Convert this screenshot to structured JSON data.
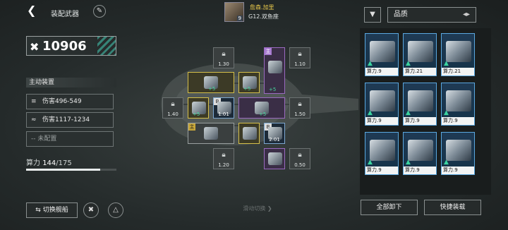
{
  "header": {
    "title": "装配武器"
  },
  "pilot": {
    "name": "詹森.加里",
    "ship": "G12.双鱼座",
    "level": "9"
  },
  "power": {
    "value": "10906"
  },
  "active_section": {
    "title": "主动装置",
    "slots": [
      "伤害496-549",
      "伤害1117-1234",
      "-- 未配置"
    ]
  },
  "capacity": {
    "label": "算力",
    "used": "144",
    "total": "/175",
    "fill": 0.823
  },
  "grid": {
    "locks": [
      "1.30",
      "1.10",
      "1.40",
      "1.50",
      "1.20",
      "0.50"
    ],
    "equipped": {
      "mark_main": "主",
      "bonus": "+5",
      "val_101": "1.01",
      "val_201": "2.01"
    }
  },
  "right_panel": {
    "sort_label": "品质",
    "cards": [
      "算力.9",
      "算力.21",
      "算力.21",
      "算力.9",
      "算力.9",
      "算力.9",
      "算力.9",
      "算力.9",
      "算力.9"
    ]
  },
  "buttons": {
    "switch_ship": "切换舰船",
    "unload_all": "全部卸下",
    "quick_equip": "快捷装载",
    "swipe_hint": "滑动切换"
  },
  "colors": {
    "accent_teal": "#3b9a8a",
    "gold": "#d6c04a",
    "purple": "#9a6ac0",
    "blue": "#5aa8e0",
    "green": "#46d49a"
  }
}
